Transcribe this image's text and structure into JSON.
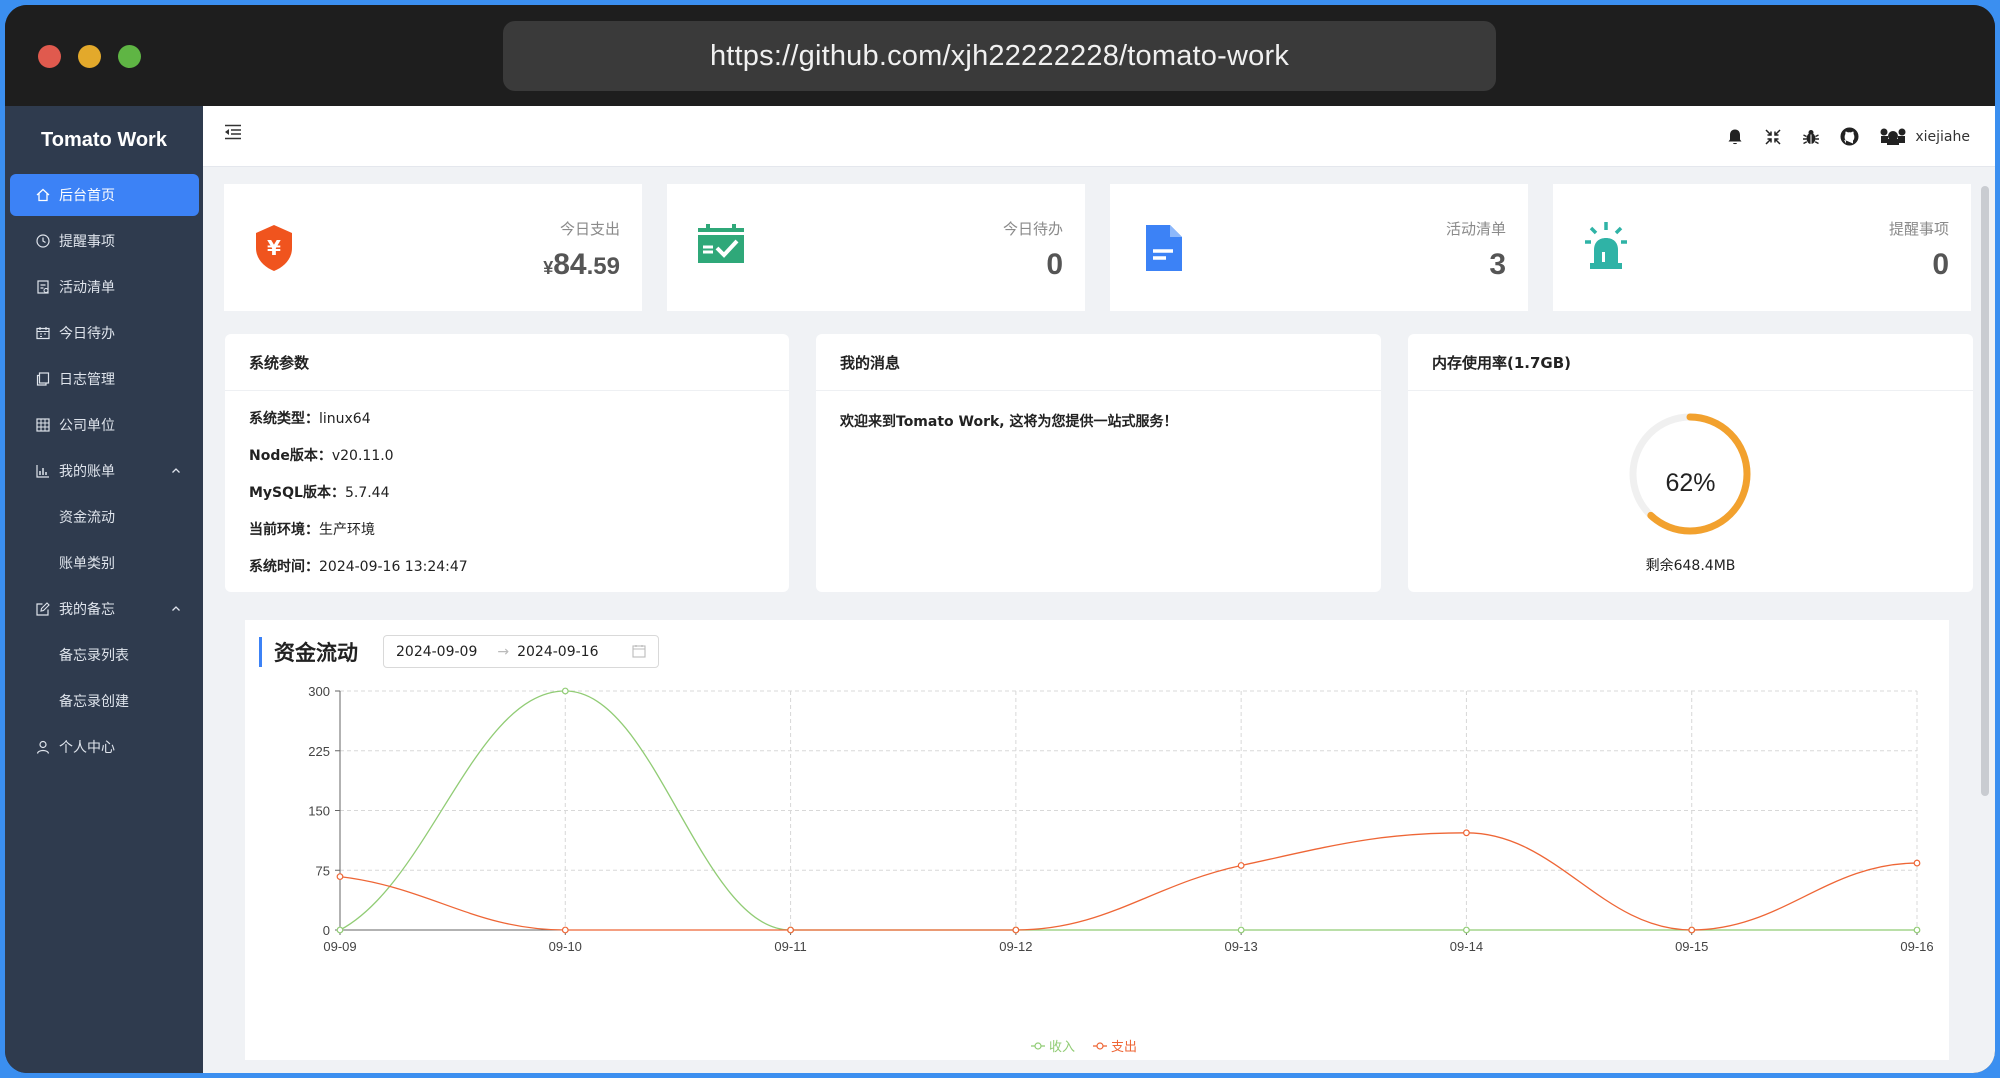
{
  "window": {
    "url": "https://github.com/xjh22222228/tomato-work"
  },
  "sidebar": {
    "logo": "Tomato Work",
    "items": [
      {
        "label": "后台首页",
        "icon": "home-icon",
        "active": true
      },
      {
        "label": "提醒事项",
        "icon": "clock-icon"
      },
      {
        "label": "活动清单",
        "icon": "checklist-icon"
      },
      {
        "label": "今日待办",
        "icon": "calendar-icon"
      },
      {
        "label": "日志管理",
        "icon": "copy-icon"
      },
      {
        "label": "公司单位",
        "icon": "table-icon"
      },
      {
        "label": "我的账单",
        "icon": "bar-chart-icon",
        "expanded": true,
        "children": [
          "资金流动",
          "账单类别"
        ]
      },
      {
        "label": "我的备忘",
        "icon": "edit-icon",
        "expanded": true,
        "children": [
          "备忘录列表",
          "备忘录创建"
        ]
      },
      {
        "label": "个人中心",
        "icon": "user-icon"
      }
    ]
  },
  "header": {
    "username": "xiejiahe",
    "icons": [
      "bell-icon",
      "fullscreen-icon",
      "bug-icon",
      "github-icon",
      "avatar-icon"
    ]
  },
  "stats": [
    {
      "label": "今日支出",
      "currency": "¥",
      "int": "84",
      "dec": ".59",
      "icon": "shield-yen-icon",
      "color": "#f0541e"
    },
    {
      "label": "今日待办",
      "value": "0",
      "icon": "calendar-check-icon",
      "color": "#2fa879"
    },
    {
      "label": "活动清单",
      "value": "3",
      "icon": "document-icon",
      "color": "#3c82f6"
    },
    {
      "label": "提醒事项",
      "value": "0",
      "icon": "alarm-icon",
      "color": "#2fb3a6"
    }
  ],
  "system": {
    "title": "系统参数",
    "rows": [
      {
        "key": "系统类型：",
        "value": "linux64"
      },
      {
        "key": "Node版本：",
        "value": "v20.11.0"
      },
      {
        "key": "MySQL版本：",
        "value": "5.7.44"
      },
      {
        "key": "当前环境：",
        "value": "生产环境"
      },
      {
        "key": "系统时间：",
        "value": "2024-09-16 13:24:47"
      }
    ]
  },
  "messages": {
    "title": "我的消息",
    "text": "欢迎来到Tomato Work, 这将为您提供一站式服务！"
  },
  "memory": {
    "title": "内存使用率(1.7GB)",
    "percent_label": "62%",
    "percent": 62,
    "footer": "剩余648.4MB",
    "color": "#f2a12e"
  },
  "cashflow": {
    "title": "资金流动",
    "date_from": "2024-09-09",
    "date_to": "2024-09-16",
    "arrow": "→"
  },
  "chart_data": {
    "type": "line",
    "categories": [
      "09-09",
      "09-10",
      "09-11",
      "09-12",
      "09-13",
      "09-14",
      "09-15",
      "09-16"
    ],
    "series": [
      {
        "name": "收入",
        "color": "#91cc75",
        "values": [
          0,
          300,
          0,
          0,
          0,
          0,
          0,
          0
        ]
      },
      {
        "name": "支出",
        "color": "#ee6636",
        "values": [
          67,
          0,
          0,
          0,
          81,
          122,
          0,
          84
        ]
      }
    ],
    "yticks": [
      0,
      75,
      150,
      225,
      300
    ],
    "ylim": [
      0,
      300
    ],
    "smooth": true,
    "grid": true,
    "legend": "bottom-center"
  }
}
